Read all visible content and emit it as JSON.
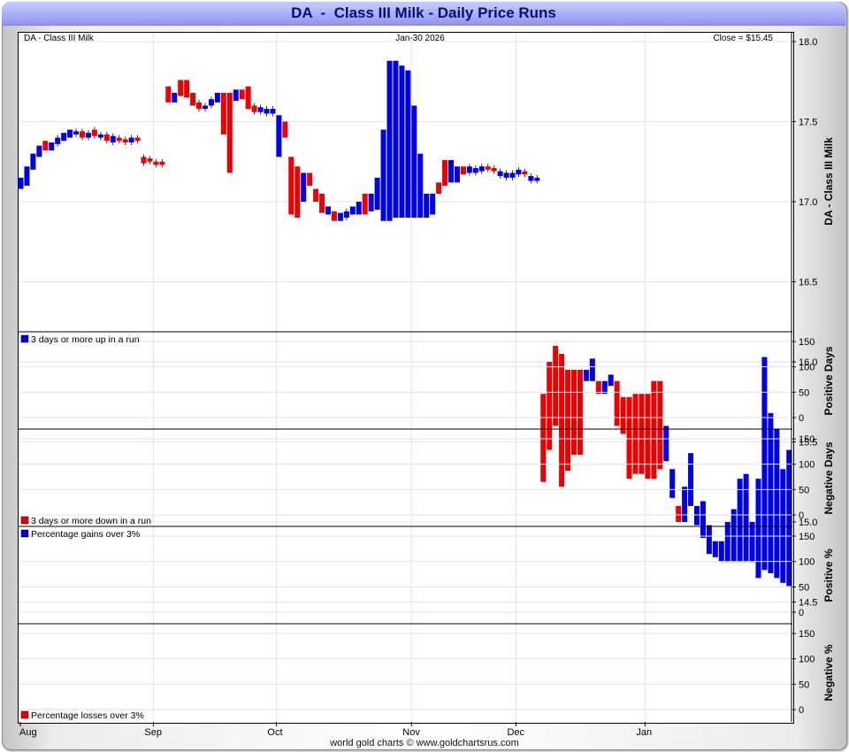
{
  "title": "DA  -  Class III Milk - Daily Price Runs",
  "credit": "world gold charts © www.goldchartsrus.com",
  "colors": {
    "up": "#0000ee",
    "down": "#ee0000",
    "grid": "#dde6ee",
    "frame_blue": "#a9adf7"
  },
  "chart_data": {
    "type": "bar",
    "subtype": "price-runs",
    "header": {
      "symbol": "DA  -  Class III Milk",
      "date": "Jan-30  2026",
      "close": "Close = $15.45"
    },
    "x_labels": [
      "Aug",
      "Sep",
      "Oct",
      "Nov",
      "Dec",
      "Jan"
    ],
    "month_start_index": [
      0,
      22,
      42,
      64,
      81,
      102
    ],
    "price_panel": {
      "ylabel": "DA  -  Class III Milk",
      "ylim": [
        14.35,
        18.1
      ],
      "ticks": [
        "18.0",
        "17.5",
        "17.0",
        "16.5",
        "16.0",
        "15.5",
        "15.0",
        "14.5"
      ],
      "bars": [
        [
          0,
          17.08,
          17.15,
          "up"
        ],
        [
          1,
          17.1,
          17.22,
          "up"
        ],
        [
          2,
          17.2,
          17.3,
          "up"
        ],
        [
          3,
          17.28,
          17.35,
          "up"
        ],
        [
          4,
          17.32,
          17.38,
          "down"
        ],
        [
          5,
          17.32,
          17.37,
          "up"
        ],
        [
          6,
          17.36,
          17.4,
          "up"
        ],
        [
          7,
          17.38,
          17.43,
          "up"
        ],
        [
          8,
          17.4,
          17.45,
          "up"
        ],
        [
          9,
          17.42,
          17.44,
          "up"
        ],
        [
          10,
          17.4,
          17.44,
          "down"
        ],
        [
          11,
          17.4,
          17.43,
          "up"
        ],
        [
          12,
          17.41,
          17.45,
          "down"
        ],
        [
          13,
          17.4,
          17.42,
          "up"
        ],
        [
          14,
          17.38,
          17.42,
          "down"
        ],
        [
          15,
          17.37,
          17.41,
          "up"
        ],
        [
          16,
          17.38,
          17.4,
          "down"
        ],
        [
          17,
          17.37,
          17.39,
          "down"
        ],
        [
          18,
          17.37,
          17.4,
          "up"
        ],
        [
          19,
          17.38,
          17.4,
          "down"
        ],
        [
          20,
          17.24,
          17.28,
          "down"
        ],
        [
          21,
          17.25,
          17.27,
          "down"
        ],
        [
          22,
          17.23,
          17.25,
          "down"
        ],
        [
          23,
          17.23,
          17.25,
          "down"
        ],
        [
          24,
          17.62,
          17.72,
          "down"
        ],
        [
          25,
          17.62,
          17.68,
          "up"
        ],
        [
          26,
          17.66,
          17.76,
          "down"
        ],
        [
          27,
          17.65,
          17.76,
          "down"
        ],
        [
          28,
          17.6,
          17.68,
          "down"
        ],
        [
          29,
          17.58,
          17.62,
          "down"
        ],
        [
          30,
          17.58,
          17.6,
          "up"
        ],
        [
          31,
          17.6,
          17.64,
          "up"
        ],
        [
          32,
          17.62,
          17.68,
          "up"
        ],
        [
          33,
          17.42,
          17.68,
          "down"
        ],
        [
          34,
          17.18,
          17.68,
          "down"
        ],
        [
          35,
          17.63,
          17.7,
          "up"
        ],
        [
          36,
          17.64,
          17.7,
          "down"
        ],
        [
          37,
          17.58,
          17.72,
          "down"
        ],
        [
          38,
          17.56,
          17.6,
          "down"
        ],
        [
          39,
          17.56,
          17.59,
          "up"
        ],
        [
          40,
          17.55,
          17.58,
          "up"
        ],
        [
          41,
          17.55,
          17.58,
          "up"
        ],
        [
          42,
          17.28,
          17.54,
          "up"
        ],
        [
          43,
          17.4,
          17.5,
          "down"
        ],
        [
          44,
          16.92,
          17.28,
          "down"
        ],
        [
          45,
          16.9,
          17.22,
          "down"
        ],
        [
          46,
          17.0,
          17.18,
          "up"
        ],
        [
          47,
          17.1,
          17.18,
          "down"
        ],
        [
          48,
          17.0,
          17.08,
          "down"
        ],
        [
          49,
          16.93,
          17.05,
          "down"
        ],
        [
          50,
          16.92,
          16.97,
          "up"
        ],
        [
          51,
          16.88,
          16.94,
          "down"
        ],
        [
          52,
          16.88,
          16.93,
          "up"
        ],
        [
          53,
          16.9,
          16.94,
          "up"
        ],
        [
          54,
          16.92,
          16.97,
          "up"
        ],
        [
          55,
          16.92,
          17.0,
          "up"
        ],
        [
          56,
          16.92,
          17.05,
          "down"
        ],
        [
          57,
          16.94,
          17.05,
          "up"
        ],
        [
          58,
          16.95,
          17.15,
          "up"
        ],
        [
          59,
          16.88,
          17.45,
          "up"
        ],
        [
          60,
          16.88,
          17.88,
          "up"
        ],
        [
          61,
          16.9,
          17.88,
          "up"
        ],
        [
          62,
          16.9,
          17.85,
          "up"
        ],
        [
          63,
          16.9,
          17.82,
          "up"
        ],
        [
          64,
          16.9,
          17.6,
          "up"
        ],
        [
          65,
          16.9,
          17.3,
          "up"
        ],
        [
          66,
          16.9,
          17.05,
          "up"
        ],
        [
          67,
          16.92,
          17.05,
          "up"
        ],
        [
          68,
          17.05,
          17.12,
          "down"
        ],
        [
          69,
          17.1,
          17.26,
          "down"
        ],
        [
          70,
          17.12,
          17.26,
          "up"
        ],
        [
          71,
          17.12,
          17.22,
          "up"
        ],
        [
          72,
          17.17,
          17.22,
          "down"
        ],
        [
          73,
          17.18,
          17.22,
          "up"
        ],
        [
          74,
          17.18,
          17.21,
          "up"
        ],
        [
          75,
          17.19,
          17.22,
          "up"
        ],
        [
          76,
          17.2,
          17.22,
          "down"
        ],
        [
          77,
          17.19,
          17.21,
          "down"
        ],
        [
          78,
          17.16,
          17.19,
          "up"
        ],
        [
          79,
          17.15,
          17.18,
          "up"
        ],
        [
          80,
          17.15,
          17.18,
          "up"
        ],
        [
          81,
          17.17,
          17.2,
          "up"
        ],
        [
          82,
          17.17,
          17.19,
          "down"
        ],
        [
          83,
          17.13,
          17.16,
          "up"
        ],
        [
          84,
          17.13,
          17.15,
          "up"
        ],
        [
          85,
          15.25,
          15.8,
          "down"
        ],
        [
          86,
          15.45,
          16.0,
          "down"
        ],
        [
          87,
          15.6,
          16.1,
          "down"
        ],
        [
          88,
          15.22,
          16.05,
          "down"
        ],
        [
          89,
          15.32,
          15.95,
          "down"
        ],
        [
          90,
          15.42,
          15.95,
          "down"
        ],
        [
          91,
          15.42,
          15.95,
          "down"
        ],
        [
          92,
          15.88,
          15.95,
          "up"
        ],
        [
          93,
          15.88,
          16.02,
          "up"
        ],
        [
          94,
          15.8,
          15.88,
          "down"
        ],
        [
          95,
          15.8,
          15.88,
          "up"
        ],
        [
          96,
          15.85,
          15.92,
          "up"
        ],
        [
          97,
          15.6,
          15.88,
          "down"
        ],
        [
          98,
          15.55,
          15.78,
          "down"
        ],
        [
          99,
          15.27,
          15.78,
          "down"
        ],
        [
          100,
          15.3,
          15.8,
          "down"
        ],
        [
          101,
          15.3,
          15.8,
          "down"
        ],
        [
          102,
          15.27,
          15.8,
          "down"
        ],
        [
          103,
          15.27,
          15.88,
          "down"
        ],
        [
          104,
          15.33,
          15.88,
          "down"
        ],
        [
          105,
          15.38,
          15.6,
          "up"
        ],
        [
          106,
          15.15,
          15.33,
          "up"
        ],
        [
          107,
          15.0,
          15.1,
          "down"
        ],
        [
          108,
          15.0,
          15.22,
          "up"
        ],
        [
          109,
          15.1,
          15.43,
          "up"
        ],
        [
          110,
          14.98,
          15.1,
          "up"
        ],
        [
          111,
          14.9,
          15.13,
          "up"
        ],
        [
          112,
          14.8,
          14.98,
          "up"
        ],
        [
          113,
          14.78,
          14.88,
          "up"
        ],
        [
          114,
          14.75,
          14.88,
          "up"
        ],
        [
          115,
          14.75,
          15.0,
          "up"
        ],
        [
          116,
          14.75,
          15.08,
          "up"
        ],
        [
          117,
          14.75,
          15.27,
          "up"
        ],
        [
          118,
          14.75,
          15.3,
          "up"
        ],
        [
          119,
          14.75,
          15.0,
          "up"
        ],
        [
          120,
          14.65,
          15.27,
          "up"
        ],
        [
          121,
          14.7,
          16.03,
          "up"
        ],
        [
          122,
          14.68,
          15.68,
          "up"
        ],
        [
          123,
          14.65,
          15.58,
          "up"
        ],
        [
          124,
          14.62,
          15.33,
          "up"
        ],
        [
          125,
          14.6,
          15.45,
          "up"
        ]
      ]
    },
    "panels": [
      {
        "label": "Positive Days",
        "legend": "3 days or more up in a run",
        "legend_pos": "top",
        "ticks": [
          "150",
          "100",
          "50",
          "0"
        ]
      },
      {
        "label": "Negative Days",
        "legend": "3 days or more down in a run",
        "legend_pos": "bottom",
        "ticks": [
          "150",
          "100",
          "50",
          "0"
        ]
      },
      {
        "label": "Positive %",
        "legend": "Percentage gains over 3%",
        "legend_pos": "top",
        "ticks": [
          "150",
          "100",
          "50",
          "0"
        ]
      },
      {
        "label": "Negative %",
        "legend": "Percentage losses over 3%",
        "legend_pos": "bottom",
        "ticks": [
          "150",
          "100",
          "50",
          "0"
        ]
      }
    ]
  }
}
